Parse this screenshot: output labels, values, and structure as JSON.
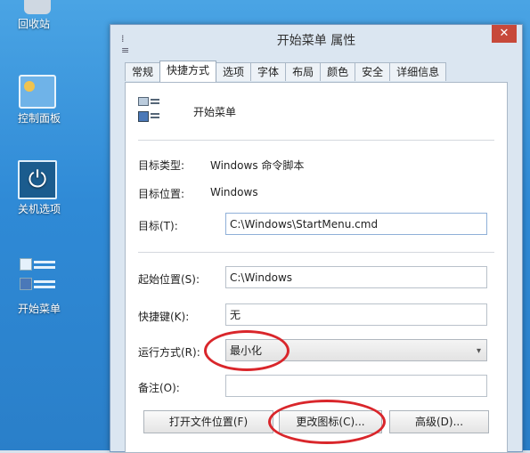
{
  "desktop": {
    "icons": [
      {
        "label": "回收站"
      },
      {
        "label": "控制面板"
      },
      {
        "label": "关机选项"
      },
      {
        "label": "开始菜单"
      }
    ]
  },
  "dialog": {
    "title": "开始菜单 属性",
    "close_symbol": "✕",
    "tabs": [
      "常规",
      "快捷方式",
      "选项",
      "字体",
      "布局",
      "颜色",
      "安全",
      "详细信息"
    ],
    "active_tab": "快捷方式",
    "shortcut_name": "开始菜单",
    "target_type_label": "目标类型:",
    "target_type_value": "Windows 命令脚本",
    "target_location_label": "目标位置:",
    "target_location_value": "Windows",
    "target_label": "目标(T):",
    "target_value": "C:\\Windows\\StartMenu.cmd",
    "start_in_label": "起始位置(S):",
    "start_in_value": "C:\\Windows",
    "hotkey_label": "快捷键(K):",
    "hotkey_value": "无",
    "run_label": "运行方式(R):",
    "run_value": "最小化",
    "comment_label": "备注(O):",
    "comment_value": "",
    "buttons": {
      "open_location": "打开文件位置(F)",
      "change_icon": "更改图标(C)...",
      "advanced": "高级(D)..."
    }
  },
  "colors": {
    "highlight_circle": "#d9262b",
    "close_button": "#c7493a",
    "desktop": "#2f8ad6"
  }
}
